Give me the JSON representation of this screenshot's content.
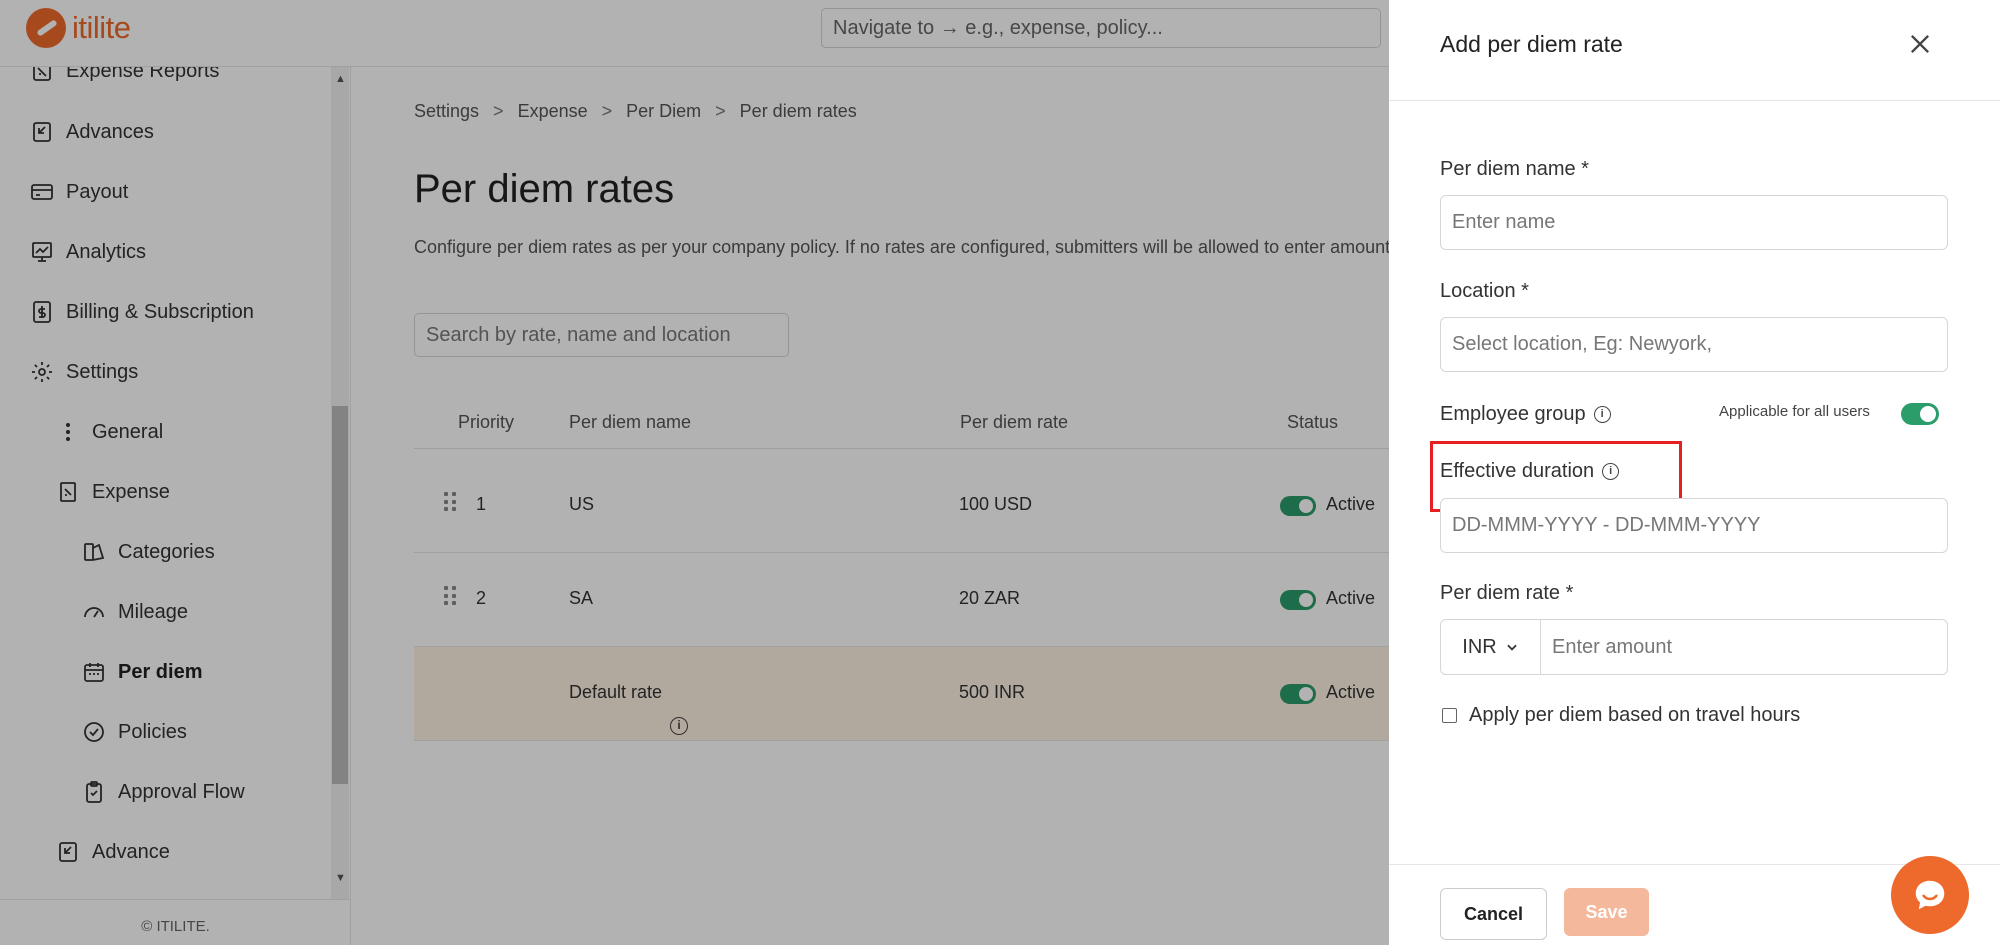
{
  "brand": {
    "name": "itilite",
    "color": "#ee6a2c"
  },
  "topbar": {
    "search_placeholder": "Navigate to → e.g., expense, policy..."
  },
  "sidebar": {
    "items": [
      {
        "label": "Expense Reports",
        "icon": "expense-report-icon"
      },
      {
        "label": "Advances",
        "icon": "advances-icon"
      },
      {
        "label": "Payout",
        "icon": "payout-card-icon"
      },
      {
        "label": "Analytics",
        "icon": "analytics-icon"
      },
      {
        "label": "Billing & Subscription",
        "icon": "billing-icon"
      },
      {
        "label": "Settings",
        "icon": "gear-icon"
      },
      {
        "label": "General",
        "icon": "kebab-icon"
      },
      {
        "label": "Expense",
        "icon": "expense-icon"
      },
      {
        "label": "Categories",
        "icon": "categories-icon"
      },
      {
        "label": "Mileage",
        "icon": "mileage-icon"
      },
      {
        "label": "Per diem",
        "icon": "calendar-icon",
        "active": true
      },
      {
        "label": "Policies",
        "icon": "policies-icon"
      },
      {
        "label": "Approval Flow",
        "icon": "clipboard-icon"
      },
      {
        "label": "Advance",
        "icon": "advance-icon"
      }
    ],
    "footer": "© ITILITE."
  },
  "main": {
    "breadcrumb": [
      "Settings",
      "Expense",
      "Per Diem",
      "Per diem rates"
    ],
    "breadcrumb_sep": ">",
    "title": "Per diem rates",
    "description": "Configure per diem rates as per your company policy. If no rates are configured, submitters will be allowed to enter amount.",
    "search_placeholder": "Search by rate, name and location",
    "table": {
      "headers": [
        "Priority",
        "Per diem name",
        "Per diem rate",
        "Status"
      ],
      "rows": [
        {
          "priority": "1",
          "name": "US",
          "rate": "100 USD",
          "status": "Active"
        },
        {
          "priority": "2",
          "name": "SA",
          "rate": "20 ZAR",
          "status": "Active"
        },
        {
          "priority": "",
          "name": "Default rate",
          "rate": "500 INR",
          "status": "Active"
        }
      ]
    }
  },
  "drawer": {
    "title": "Add per diem rate",
    "fields": {
      "name_label": "Per diem name *",
      "name_placeholder": "Enter name",
      "location_label": "Location *",
      "location_placeholder": "Select location, Eg: Newyork,",
      "group_label": "Employee group",
      "group_toggle_label": "Applicable for all users",
      "duration_label": "Effective duration",
      "duration_placeholder": "DD-MMM-YYYY - DD-MMM-YYYY",
      "rate_label": "Per diem rate *",
      "currency": "INR",
      "amount_placeholder": "Enter amount",
      "travel_hours_label": "Apply per diem based on travel hours"
    },
    "cancel_label": "Cancel",
    "save_label": "Save"
  },
  "colors": {
    "accent": "#ee6a2c",
    "toggle_on": "#2a9d6a",
    "highlight": "#e62020",
    "save_disabled": "#f4b89d"
  }
}
